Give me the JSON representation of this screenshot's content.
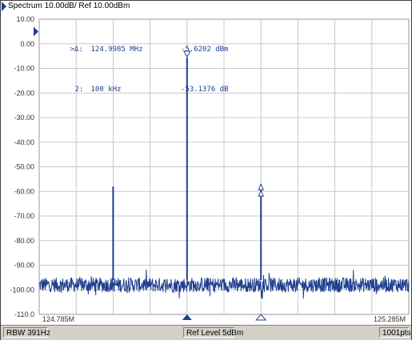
{
  "window": {
    "title": "Spectrum 10.00dB/ Ref 10.00dBm"
  },
  "markers": [
    {
      "label": ">Δ:",
      "freq": "124.9985 MHz",
      "value": "-5.6202 dBm"
    },
    {
      "label": "2:",
      "freq": "100 kHz",
      "value": "-53.1376 dB"
    }
  ],
  "status": {
    "rbw": "RBW 391Hz",
    "ref_level": "Ref Level 5dBm",
    "points": "1001pts"
  },
  "colors": {
    "trace": "#1f3f8f",
    "grid": "#c8c8c8",
    "background": "#ffffff"
  },
  "chart_data": {
    "type": "line",
    "title": "Spectrum 10.00dB/ Ref 10.00dBm",
    "xlabel": "",
    "ylabel": "",
    "x_start_label": "124.785M",
    "x_end_label": "125.285M",
    "x_range_mhz": [
      124.785,
      125.285
    ],
    "ylim": [
      -110,
      10
    ],
    "yticks": [
      "10.00",
      "0.00",
      "-10.00",
      "-20.00",
      "-30.00",
      "-40.00",
      "-50.00",
      "-60.00",
      "-70.00",
      "-80.00",
      "-90.00",
      "-100.00",
      "-110.0"
    ],
    "grid": true,
    "noise_floor_dbm": -98,
    "peaks": [
      {
        "freq_mhz": 124.885,
        "level_dbm": -58
      },
      {
        "freq_mhz": 124.985,
        "level_dbm": -5.6
      },
      {
        "freq_mhz": 125.085,
        "level_dbm": -58
      }
    ]
  }
}
